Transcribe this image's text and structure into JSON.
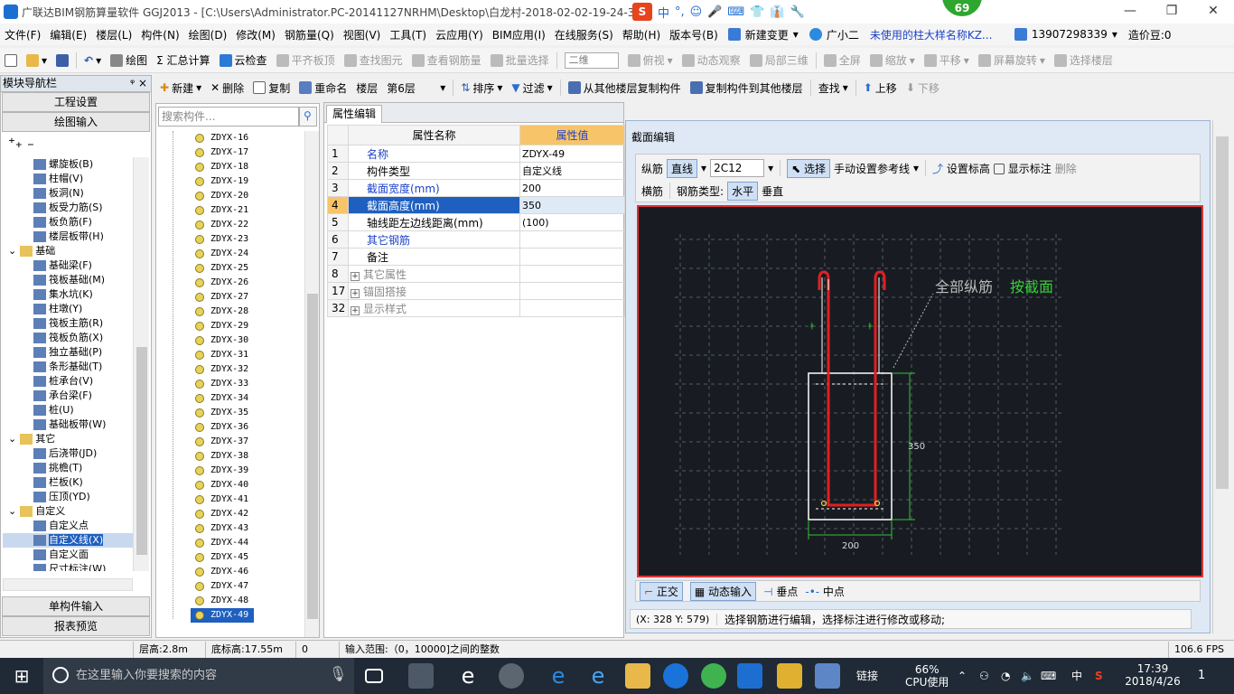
{
  "title": "广联达BIM钢筋算量软件 GGJ2013 - [C:\\Users\\Administrator.PC-20141127NRHM\\Desktop\\白龙村-2018-02-02-19-24-35",
  "ime": {
    "logo": "S",
    "items": [
      "中",
      "°,",
      "☺",
      "🎤",
      "⌨",
      "👕",
      "👔",
      "🔧"
    ]
  },
  "badge": "69",
  "window_buttons": [
    "—",
    "❐",
    "✕"
  ],
  "menu": [
    "文件(F)",
    "编辑(E)",
    "楼层(L)",
    "构件(N)",
    "绘图(D)",
    "修改(M)",
    "钢筋量(Q)",
    "视图(V)",
    "工具(T)",
    "云应用(Y)",
    "BIM应用(I)",
    "在线服务(S)",
    "帮助(H)",
    "版本号(B)"
  ],
  "menu_extra": {
    "new_change": "新建变更",
    "xiaoer": "广小二",
    "notice": "未使用的柱大样名称KZ...",
    "phone": "13907298339",
    "price": "造价豆:0"
  },
  "toolbar1": [
    "绘图",
    "Σ 汇总计算",
    "云检查",
    "平齐板顶",
    "查找图元",
    "查看钢筋量",
    "批量选择",
    "二维",
    "俯视",
    "动态观察",
    "局部三维",
    "全屏",
    "缩放",
    "平移",
    "屏幕旋转",
    "选择楼层"
  ],
  "toolbar2": {
    "new": "新建",
    "delete": "删除",
    "copy": "复制",
    "rename": "重命名",
    "floor_label": "楼层",
    "floor_value": "第6层",
    "sort": "排序",
    "filter": "过滤",
    "copy_from": "从其他楼层复制构件",
    "copy_to": "复制构件到其他楼层",
    "find": "查找",
    "up": "上移",
    "down": "下移"
  },
  "left_panel": {
    "title": "模块导航栏",
    "pin": "ᵠ ×",
    "buttons_top": [
      "工程设置",
      "绘图输入"
    ],
    "tree": [
      {
        "label": "螺旋板(B)",
        "indent": 3
      },
      {
        "label": "柱帽(V)",
        "indent": 3
      },
      {
        "label": "板洞(N)",
        "indent": 3
      },
      {
        "label": "板受力筋(S)",
        "indent": 3
      },
      {
        "label": "板负筋(F)",
        "indent": 3
      },
      {
        "label": "楼层板带(H)",
        "indent": 3
      },
      {
        "label": "基础",
        "indent": 1,
        "folder": true,
        "expand": "⌄"
      },
      {
        "label": "基础梁(F)",
        "indent": 3
      },
      {
        "label": "筏板基础(M)",
        "indent": 3
      },
      {
        "label": "集水坑(K)",
        "indent": 3
      },
      {
        "label": "柱墩(Y)",
        "indent": 3
      },
      {
        "label": "筏板主筋(R)",
        "indent": 3
      },
      {
        "label": "筏板负筋(X)",
        "indent": 3
      },
      {
        "label": "独立基础(P)",
        "indent": 3
      },
      {
        "label": "条形基础(T)",
        "indent": 3
      },
      {
        "label": "桩承台(V)",
        "indent": 3
      },
      {
        "label": "承台梁(F)",
        "indent": 3
      },
      {
        "label": "桩(U)",
        "indent": 3
      },
      {
        "label": "基础板带(W)",
        "indent": 3
      },
      {
        "label": "其它",
        "indent": 1,
        "folder": true,
        "expand": "⌄"
      },
      {
        "label": "后浇带(JD)",
        "indent": 3
      },
      {
        "label": "挑檐(T)",
        "indent": 3
      },
      {
        "label": "栏板(K)",
        "indent": 3
      },
      {
        "label": "压顶(YD)",
        "indent": 3
      },
      {
        "label": "自定义",
        "indent": 1,
        "folder": true,
        "expand": "⌄"
      },
      {
        "label": "自定义点",
        "indent": 3
      },
      {
        "label": "自定义线(X)",
        "indent": 3,
        "selected": true
      },
      {
        "label": "自定义面",
        "indent": 3
      },
      {
        "label": "尺寸标注(W)",
        "indent": 3
      }
    ],
    "buttons_bottom": [
      "单构件输入",
      "报表预览"
    ]
  },
  "search_placeholder": "搜索构件...",
  "components": [
    "ZDYX-16",
    "ZDYX-17",
    "ZDYX-18",
    "ZDYX-19",
    "ZDYX-20",
    "ZDYX-21",
    "ZDYX-22",
    "ZDYX-23",
    "ZDYX-24",
    "ZDYX-25",
    "ZDYX-26",
    "ZDYX-27",
    "ZDYX-28",
    "ZDYX-29",
    "ZDYX-30",
    "ZDYX-31",
    "ZDYX-32",
    "ZDYX-33",
    "ZDYX-34",
    "ZDYX-35",
    "ZDYX-36",
    "ZDYX-37",
    "ZDYX-38",
    "ZDYX-39",
    "ZDYX-40",
    "ZDYX-41",
    "ZDYX-42",
    "ZDYX-43",
    "ZDYX-44",
    "ZDYX-45",
    "ZDYX-46",
    "ZDYX-47",
    "ZDYX-48",
    "ZDYX-49"
  ],
  "selected_component": "ZDYX-49",
  "prop": {
    "tab": "属性编辑",
    "col_name": "属性名称",
    "col_value": "属性值",
    "rows": [
      {
        "n": "1",
        "k": "名称",
        "v": "ZDYX-49",
        "blue": true
      },
      {
        "n": "2",
        "k": "构件类型",
        "v": "自定义线"
      },
      {
        "n": "3",
        "k": "截面宽度(mm)",
        "v": "200",
        "blue": true
      },
      {
        "n": "4",
        "k": "截面高度(mm)",
        "v": "350",
        "blue": true,
        "selected": true
      },
      {
        "n": "5",
        "k": "轴线距左边线距离(mm)",
        "v": "(100)"
      },
      {
        "n": "6",
        "k": "其它钢筋",
        "v": "",
        "blue": true
      },
      {
        "n": "7",
        "k": "备注",
        "v": ""
      },
      {
        "n": "8",
        "k": "其它属性",
        "v": "",
        "group": true
      },
      {
        "n": "17",
        "k": "锚固搭接",
        "v": "",
        "group": true
      },
      {
        "n": "32",
        "k": "显示样式",
        "v": "",
        "group": true
      }
    ]
  },
  "dialog": {
    "title": "截面编辑",
    "row1": {
      "longitudinal": "纵筋",
      "straight": "直线",
      "rebar": "2C12",
      "select": "选择",
      "manual_ref": "手动设置参考线",
      "set_elev": "设置标高",
      "show_label": "显示标注",
      "delete": "删除"
    },
    "row2": {
      "stirrup": "横筋",
      "rebar_type_label": "钢筋类型:",
      "horizontal": "水平",
      "vertical": "垂直"
    },
    "canvas": {
      "note": "全部纵筋",
      "note_highlight": "按截面",
      "dim_height": "350",
      "dim_width": "200"
    },
    "status_buttons": {
      "ortho": "正交",
      "dynamic": "动态输入",
      "perp": "垂点",
      "mid": "中点"
    },
    "coords": "(X: 328 Y: 579)",
    "hint": "选择钢筋进行编辑，选择标注进行修改或移动;"
  },
  "statusbar": {
    "floor_height": "层高:2.8m",
    "bottom_elev": "底标高:17.55m",
    "zero": "0",
    "input_range": "输入范围:（0，10000]之间的整数",
    "fps": "106.6 FPS"
  },
  "taskbar": {
    "search": "在这里输入你要搜索的内容",
    "link": "链接",
    "cpu_pct": "66%",
    "cpu_label": "CPU使用",
    "lang": "中",
    "time": "17:39",
    "date": "2018/4/26",
    "notif": "1"
  },
  "colors": {
    "accent": "#1f5fbf",
    "canvas_bg": "#181c22",
    "canvas_border": "#e53030",
    "rebar": "#e02020",
    "dim": "#35c235",
    "highlight_green": "#38d038",
    "badge": "#2fa62f"
  }
}
